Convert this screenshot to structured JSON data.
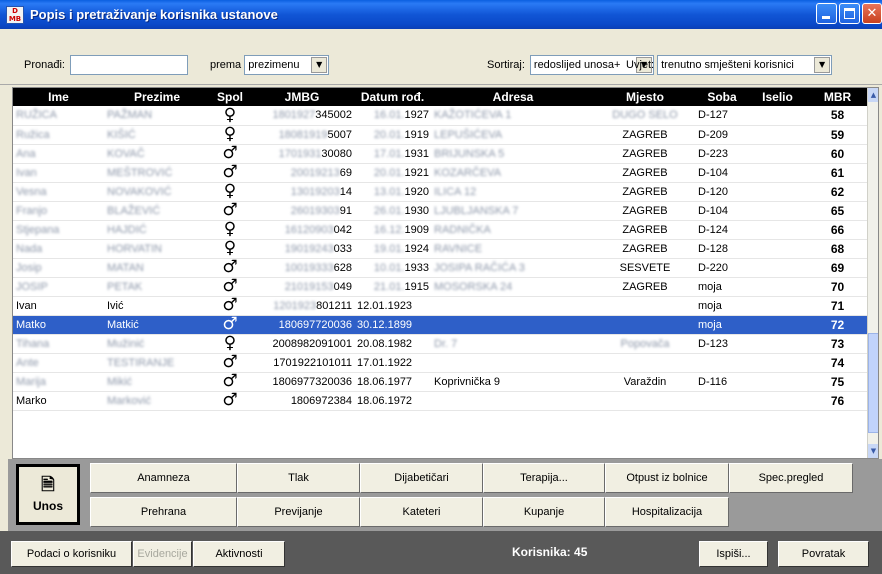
{
  "window": {
    "title": "Popis i pretraživanje korisnika ustanove",
    "icon_text": "D MB"
  },
  "filters": {
    "search_label": "Pronađi:",
    "search_value": "",
    "by_label": "prema",
    "by_value": "prezimenu",
    "sort_label": "Sortiraj:",
    "sort_value": "redoslijed unosa+",
    "condition_label": "Uvjet:",
    "condition_value": "trenutno smješteni korisnici"
  },
  "table": {
    "columns": [
      "Ime",
      "Prezime",
      "Spol",
      "JMBG",
      "Datum rođ.",
      "Adresa",
      "Mjesto",
      "Soba",
      "Iselio",
      "MBR"
    ],
    "rows": [
      {
        "ime": "RUŽICA",
        "prezime": "PAŽMAN",
        "spol": "♀",
        "jmbg_blur": "1801927",
        "jmbg": "345002",
        "datum_blur": "16.01.",
        "datum": "1927",
        "adresa": "KAŽOTIĆEVA 1",
        "mjesto": "DUGO SELO",
        "soba": "D-127",
        "iselio": "",
        "mbr": "58"
      },
      {
        "ime": "Ružica",
        "prezime": "KIŠIĆ",
        "spol": "♀",
        "jmbg_blur": "18081919",
        "jmbg": "5007",
        "datum_blur": "20.01.",
        "datum": "1919",
        "adresa": "LEPUŠIĆEVA",
        "mjesto": "ZAGREB",
        "soba": "D-209",
        "iselio": "",
        "mbr": "59"
      },
      {
        "ime": "Ana",
        "prezime": "KOVAČ",
        "spol": "♂",
        "jmbg_blur": "1701931",
        "jmbg": "30080",
        "datum_blur": "17.01.",
        "datum": "1931",
        "adresa": "BRIJUNSKA 5",
        "mjesto": "ZAGREB",
        "soba": "D-223",
        "iselio": "",
        "mbr": "60"
      },
      {
        "ime": "Ivan",
        "prezime": "MEŠTROVIĆ",
        "spol": "♂",
        "jmbg_blur": "20019213",
        "jmbg": "69",
        "datum_blur": "20.01.",
        "datum": "1921",
        "adresa": "KOZARČEVA",
        "mjesto": "ZAGREB",
        "soba": "D-104",
        "iselio": "",
        "mbr": "61"
      },
      {
        "ime": "Vesna",
        "prezime": "NOVAKOVIĆ",
        "spol": "♀",
        "jmbg_blur": "13019203",
        "jmbg": "14",
        "datum_blur": "13.01.",
        "datum": "1920",
        "adresa": "ILICA 12",
        "mjesto": "ZAGREB",
        "soba": "D-120",
        "iselio": "",
        "mbr": "62"
      },
      {
        "ime": "Franjo",
        "prezime": "BLAŽEVIĆ",
        "spol": "♂",
        "jmbg_blur": "26019303",
        "jmbg": "91",
        "datum_blur": "26.01.",
        "datum": "1930",
        "adresa": "LJUBLJANSKA 7",
        "mjesto": "ZAGREB",
        "soba": "D-104",
        "iselio": "",
        "mbr": "65"
      },
      {
        "ime": "Stjepana",
        "prezime": "HAJDIĆ",
        "spol": "♀",
        "jmbg_blur": "16120903",
        "jmbg": "042",
        "datum_blur": "16.12.",
        "datum": "1909",
        "adresa": "RADNIČKA",
        "mjesto": "ZAGREB",
        "soba": "D-124",
        "iselio": "",
        "mbr": "66"
      },
      {
        "ime": "Nada",
        "prezime": "HORVATIN",
        "spol": "♀",
        "jmbg_blur": "19019243",
        "jmbg": "033",
        "datum_blur": "19.01.",
        "datum": "1924",
        "adresa": "RAVNICE",
        "mjesto": "ZAGREB",
        "soba": "D-128",
        "iselio": "",
        "mbr": "68"
      },
      {
        "ime": "Josip",
        "prezime": "MATAN",
        "spol": "♂",
        "jmbg_blur": "10019333",
        "jmbg": "628",
        "datum_blur": "10.01.",
        "datum": "1933",
        "adresa": "JOSIPA RAČIĆA 3",
        "mjesto": "SESVETE",
        "soba": "D-220",
        "iselio": "",
        "mbr": "69"
      },
      {
        "ime": "JOSIP",
        "prezime": "PETAK",
        "spol": "♂",
        "jmbg_blur": "21019153",
        "jmbg": "049",
        "datum_blur": "21.01.",
        "datum": "1915",
        "adresa": "MOSORSKA 24",
        "mjesto": "ZAGREB",
        "soba": "moja",
        "iselio": "",
        "mbr": "70"
      },
      {
        "ime": "Ivan",
        "prezime": "Ivić",
        "spol": "♂",
        "jmbg_blur": "1201923",
        "jmbg": "801211",
        "datum_blur": "",
        "datum": "12.01.1923",
        "adresa": "",
        "mjesto": "",
        "soba": "moja",
        "iselio": "",
        "mbr": "71"
      },
      {
        "ime": "Matko",
        "prezime": "Matkić",
        "spol": "♂",
        "jmbg_blur": "",
        "jmbg": "180697720036",
        "datum_blur": "",
        "datum": "30.12.1899",
        "adresa": "",
        "mjesto": "",
        "soba": "moja",
        "iselio": "",
        "mbr": "72",
        "selected": true
      },
      {
        "ime": "Tihana",
        "prezime": "Mužinić",
        "spol": "♀",
        "jmbg_blur": "",
        "jmbg": "2008982091001",
        "datum_blur": "",
        "datum": "20.08.1982",
        "adresa": "Dr. 7",
        "mjesto": "Popovača",
        "soba": "D-123",
        "iselio": "",
        "mbr": "73"
      },
      {
        "ime": "Ante",
        "prezime": "TESTIRANJE",
        "spol": "♂",
        "jmbg_blur": "",
        "jmbg": "1701922101011",
        "datum_blur": "",
        "datum": "17.01.1922",
        "adresa": "",
        "mjesto": "",
        "soba": "",
        "iselio": "",
        "mbr": "74"
      },
      {
        "ime": "Marija",
        "prezime": "Mikić",
        "spol": "♂",
        "jmbg_blur": "",
        "jmbg": "1806977320036",
        "datum_blur": "",
        "datum": "18.06.1977",
        "adresa": "Koprivnička 9",
        "mjesto": "Varaždin",
        "soba": "D-116",
        "iselio": "",
        "mbr": "75"
      },
      {
        "ime": "Marko",
        "prezime": "Marković",
        "spol": "♂",
        "jmbg_blur": "",
        "jmbg": "1806972384",
        "datum_blur": "",
        "datum": "18.06.1972",
        "adresa": "",
        "mjesto": "",
        "soba": "",
        "iselio": "",
        "mbr": "76"
      }
    ]
  },
  "buttons": {
    "unos": "Unos",
    "row1": [
      "Anamneza",
      "Tlak",
      "Dijabetičari",
      "Terapija...",
      "Otpust iz bolnice",
      "Spec.pregled"
    ],
    "row2": [
      "Prehrana",
      "Previjanje",
      "Kateteri",
      "Kupanje",
      "Hospitalizacija"
    ]
  },
  "footer": {
    "podaci": "Podaci o korisniku",
    "evidencije": "Evidencije",
    "aktivnosti": "Aktivnosti",
    "count_label": "Korisnika: 45",
    "ispisi": "Ispiši...",
    "povratak": "Povratak"
  }
}
